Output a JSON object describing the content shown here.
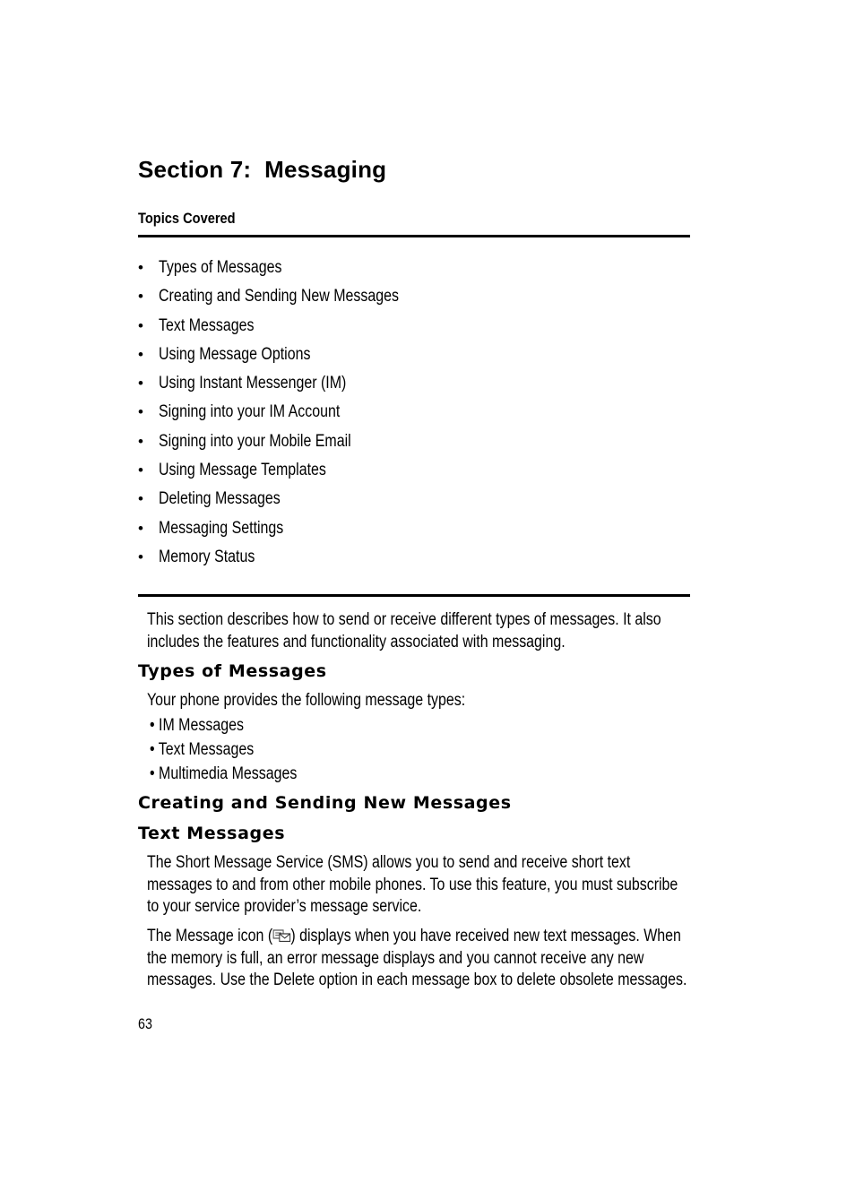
{
  "section_title": "Section 7:  Messaging",
  "topics_covered": {
    "heading": "Topics Covered",
    "bullet": "•",
    "items": [
      "Types of Messages",
      "Creating and Sending New Messages",
      "Text Messages",
      "Using Message Options",
      "Using Instant Messenger (IM)",
      "Signing into your IM Account",
      "Signing into your Mobile Email",
      "Using Message Templates",
      "Deleting Messages",
      "Messaging Settings",
      "Memory Status"
    ]
  },
  "intro": {
    "lines": [
      "This section describes how to send or receive different types of messages. It also",
      "includes the features and functionality associated with messaging."
    ]
  },
  "types_of_messages": {
    "heading": "Types of Messages",
    "lead": "Your phone provides the following message types:",
    "items": [
      "• IM Messages",
      "• Text Messages",
      "• Multimedia Messages"
    ]
  },
  "creating_sending": {
    "heading": "Creating and Sending New Messages"
  },
  "text_messages": {
    "heading": "Text Messages",
    "paragraph1": [
      "The Short Message Service (SMS) allows you to send and receive short text",
      "messages to and from other mobile phones. To use this feature, you must subscribe",
      "to your service provider’s message service."
    ],
    "paragraph2": {
      "line1_before_icon": "The Message icon (",
      "icon": "message-envelope-icon",
      "line1_after_icon": ") displays when you have received new text messages. When",
      "line2": "the memory is full, an error message displays and you cannot receive any new",
      "line3": "messages. Use the Delete option in each message box to delete obsolete messages."
    }
  },
  "page_number": "63"
}
